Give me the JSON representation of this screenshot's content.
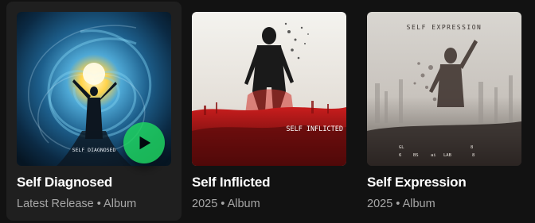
{
  "albums": [
    {
      "title": "Self Diagnosed",
      "subtitle": "Latest Release • Album",
      "cover_text": "SELF DIAGNOSED",
      "cover_icon": "play-icon"
    },
    {
      "title": "Self Inflicted",
      "subtitle": "2025 • Album",
      "cover_text": "SELF INFLICTED"
    },
    {
      "title": "Self Expression",
      "subtitle": "2025 • Album",
      "cover_text": "SELF EXPRESSION",
      "cover_footer": [
        "GL",
        "8",
        "6",
        "BS",
        "ai",
        "LAB",
        "8"
      ]
    }
  ],
  "colors": {
    "background": "#121212",
    "card_hover": "#1f1f1f",
    "accent_green": "#1ed760",
    "title": "#ffffff",
    "subtitle": "#a7a7a7"
  }
}
